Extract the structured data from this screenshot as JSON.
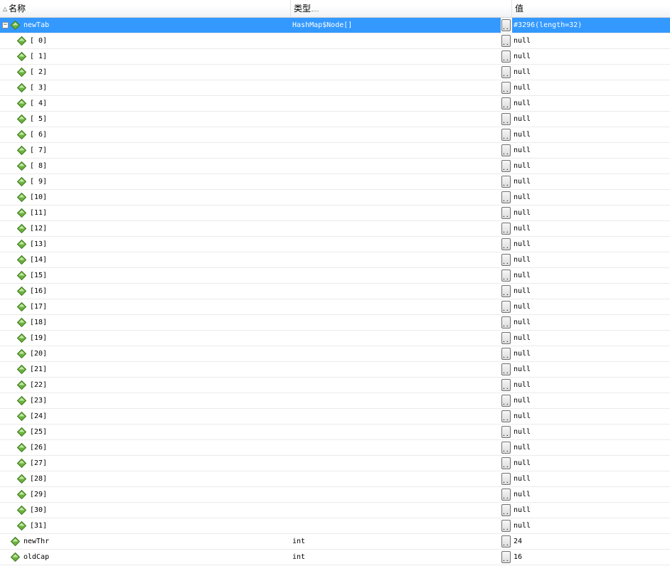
{
  "header": {
    "name_label": "名称",
    "type_label": "类型",
    "value_label": "值",
    "sort_arrow_icon": "sort-ascending-icon"
  },
  "colors": {
    "selection": "#3399ff",
    "diamond_fill": "#6db33f",
    "diamond_dark": "#3d7a1f"
  },
  "rows": [
    {
      "name": "newTab",
      "type": "HashMap$Node[]",
      "value": "#3296(length=32)",
      "level": 0,
      "expanded": true,
      "selected": true
    },
    {
      "name": "[ 0]",
      "type": "",
      "value": "null",
      "level": 1
    },
    {
      "name": "[ 1]",
      "type": "",
      "value": "null",
      "level": 1
    },
    {
      "name": "[ 2]",
      "type": "",
      "value": "null",
      "level": 1
    },
    {
      "name": "[ 3]",
      "type": "",
      "value": "null",
      "level": 1
    },
    {
      "name": "[ 4]",
      "type": "",
      "value": "null",
      "level": 1
    },
    {
      "name": "[ 5]",
      "type": "",
      "value": "null",
      "level": 1
    },
    {
      "name": "[ 6]",
      "type": "",
      "value": "null",
      "level": 1
    },
    {
      "name": "[ 7]",
      "type": "",
      "value": "null",
      "level": 1
    },
    {
      "name": "[ 8]",
      "type": "",
      "value": "null",
      "level": 1
    },
    {
      "name": "[ 9]",
      "type": "",
      "value": "null",
      "level": 1
    },
    {
      "name": "[10]",
      "type": "",
      "value": "null",
      "level": 1
    },
    {
      "name": "[11]",
      "type": "",
      "value": "null",
      "level": 1
    },
    {
      "name": "[12]",
      "type": "",
      "value": "null",
      "level": 1
    },
    {
      "name": "[13]",
      "type": "",
      "value": "null",
      "level": 1
    },
    {
      "name": "[14]",
      "type": "",
      "value": "null",
      "level": 1
    },
    {
      "name": "[15]",
      "type": "",
      "value": "null",
      "level": 1
    },
    {
      "name": "[16]",
      "type": "",
      "value": "null",
      "level": 1
    },
    {
      "name": "[17]",
      "type": "",
      "value": "null",
      "level": 1
    },
    {
      "name": "[18]",
      "type": "",
      "value": "null",
      "level": 1
    },
    {
      "name": "[19]",
      "type": "",
      "value": "null",
      "level": 1
    },
    {
      "name": "[20]",
      "type": "",
      "value": "null",
      "level": 1
    },
    {
      "name": "[21]",
      "type": "",
      "value": "null",
      "level": 1
    },
    {
      "name": "[22]",
      "type": "",
      "value": "null",
      "level": 1
    },
    {
      "name": "[23]",
      "type": "",
      "value": "null",
      "level": 1
    },
    {
      "name": "[24]",
      "type": "",
      "value": "null",
      "level": 1
    },
    {
      "name": "[25]",
      "type": "",
      "value": "null",
      "level": 1
    },
    {
      "name": "[26]",
      "type": "",
      "value": "null",
      "level": 1
    },
    {
      "name": "[27]",
      "type": "",
      "value": "null",
      "level": 1
    },
    {
      "name": "[28]",
      "type": "",
      "value": "null",
      "level": 1
    },
    {
      "name": "[29]",
      "type": "",
      "value": "null",
      "level": 1
    },
    {
      "name": "[30]",
      "type": "",
      "value": "null",
      "level": 1
    },
    {
      "name": "[31]",
      "type": "",
      "value": "null",
      "level": 1
    },
    {
      "name": "newThr",
      "type": "int",
      "value": "24",
      "level": 0
    },
    {
      "name": "oldCap",
      "type": "int",
      "value": "16",
      "level": 0
    }
  ],
  "ellipsis_label": "..."
}
